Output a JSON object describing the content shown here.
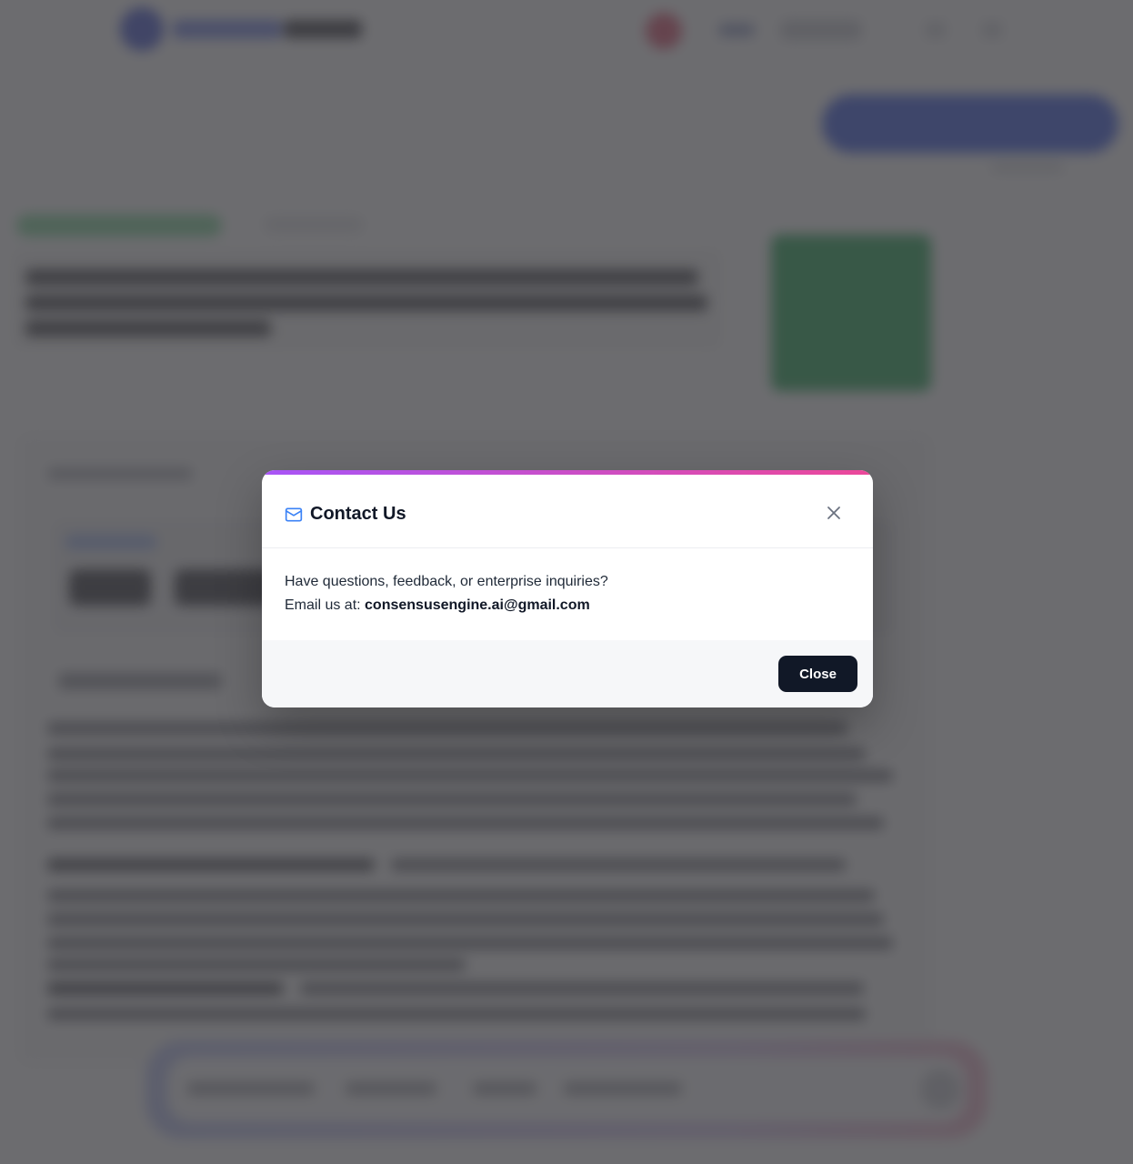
{
  "modal": {
    "title": "Contact Us",
    "title_icon": "mail-icon",
    "close_icon": "close-icon",
    "body_line1": "Have questions, feedback, or enterprise inquiries?",
    "email_prefix": "Email us at: ",
    "email": "consensusengine.ai@gmail.com",
    "close_label": "Close"
  },
  "colors": {
    "accent_start": "#a855f7",
    "accent_end": "#ec4899",
    "icon_blue": "#3b82f6",
    "button_bg": "#111827",
    "overlay": "#424346"
  }
}
